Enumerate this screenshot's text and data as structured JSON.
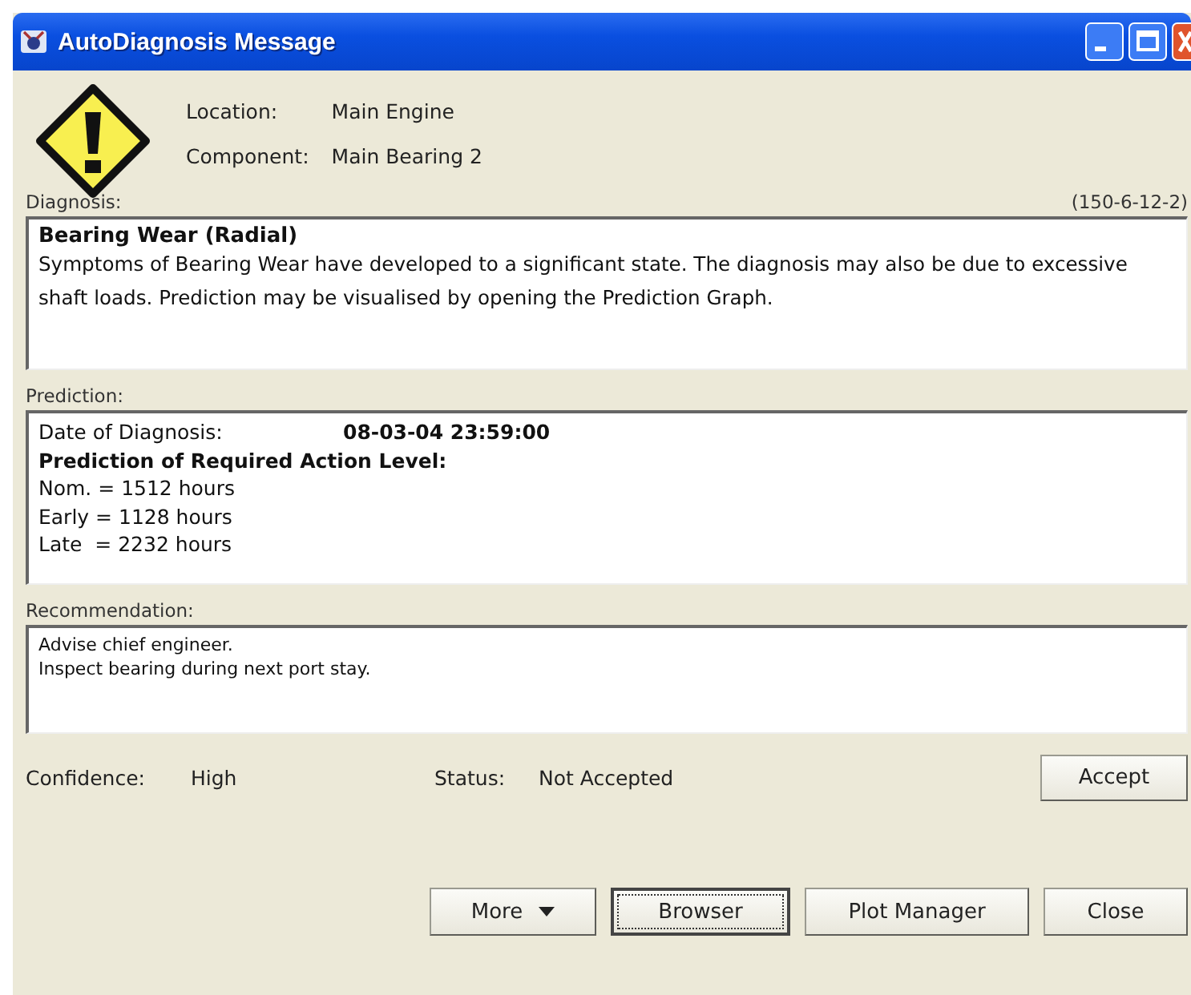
{
  "window": {
    "title": "AutoDiagnosis Message"
  },
  "header": {
    "fields": [
      {
        "label": "Location:",
        "value": "Main Engine"
      },
      {
        "label": "Component:",
        "value": "Main Bearing 2"
      }
    ]
  },
  "diagnosis": {
    "label": "Diagnosis:",
    "code": "(150-6-12-2)",
    "title": "Bearing Wear (Radial)",
    "text": "Symptoms of Bearing Wear have developed to a significant state. The diagnosis may also be due to excessive shaft loads. Prediction may be visualised by opening the Prediction Graph."
  },
  "prediction": {
    "label": "Prediction:",
    "date_label": "Date of Diagnosis:",
    "date_value": "08-03-04 23:59:00",
    "heading": "Prediction of Required Action Level:",
    "lines": [
      "Nom. = 1512 hours",
      "Early = 1128 hours",
      "Late  = 2232 hours"
    ]
  },
  "recommendation": {
    "label": "Recommendation:",
    "lines": [
      "Advise chief engineer.",
      "Inspect bearing during next port stay."
    ]
  },
  "confidence": {
    "label": "Confidence:",
    "value": "High"
  },
  "status": {
    "label": "Status:",
    "value": "Not Accepted"
  },
  "accept_button": "Accept",
  "buttons": [
    {
      "label": "More",
      "kind": "dropdown",
      "focused": false
    },
    {
      "label": "Browser",
      "kind": "plain",
      "focused": true
    },
    {
      "label": "Plot Manager",
      "kind": "plain",
      "focused": false
    },
    {
      "label": "Close",
      "kind": "plain",
      "focused": false
    }
  ]
}
